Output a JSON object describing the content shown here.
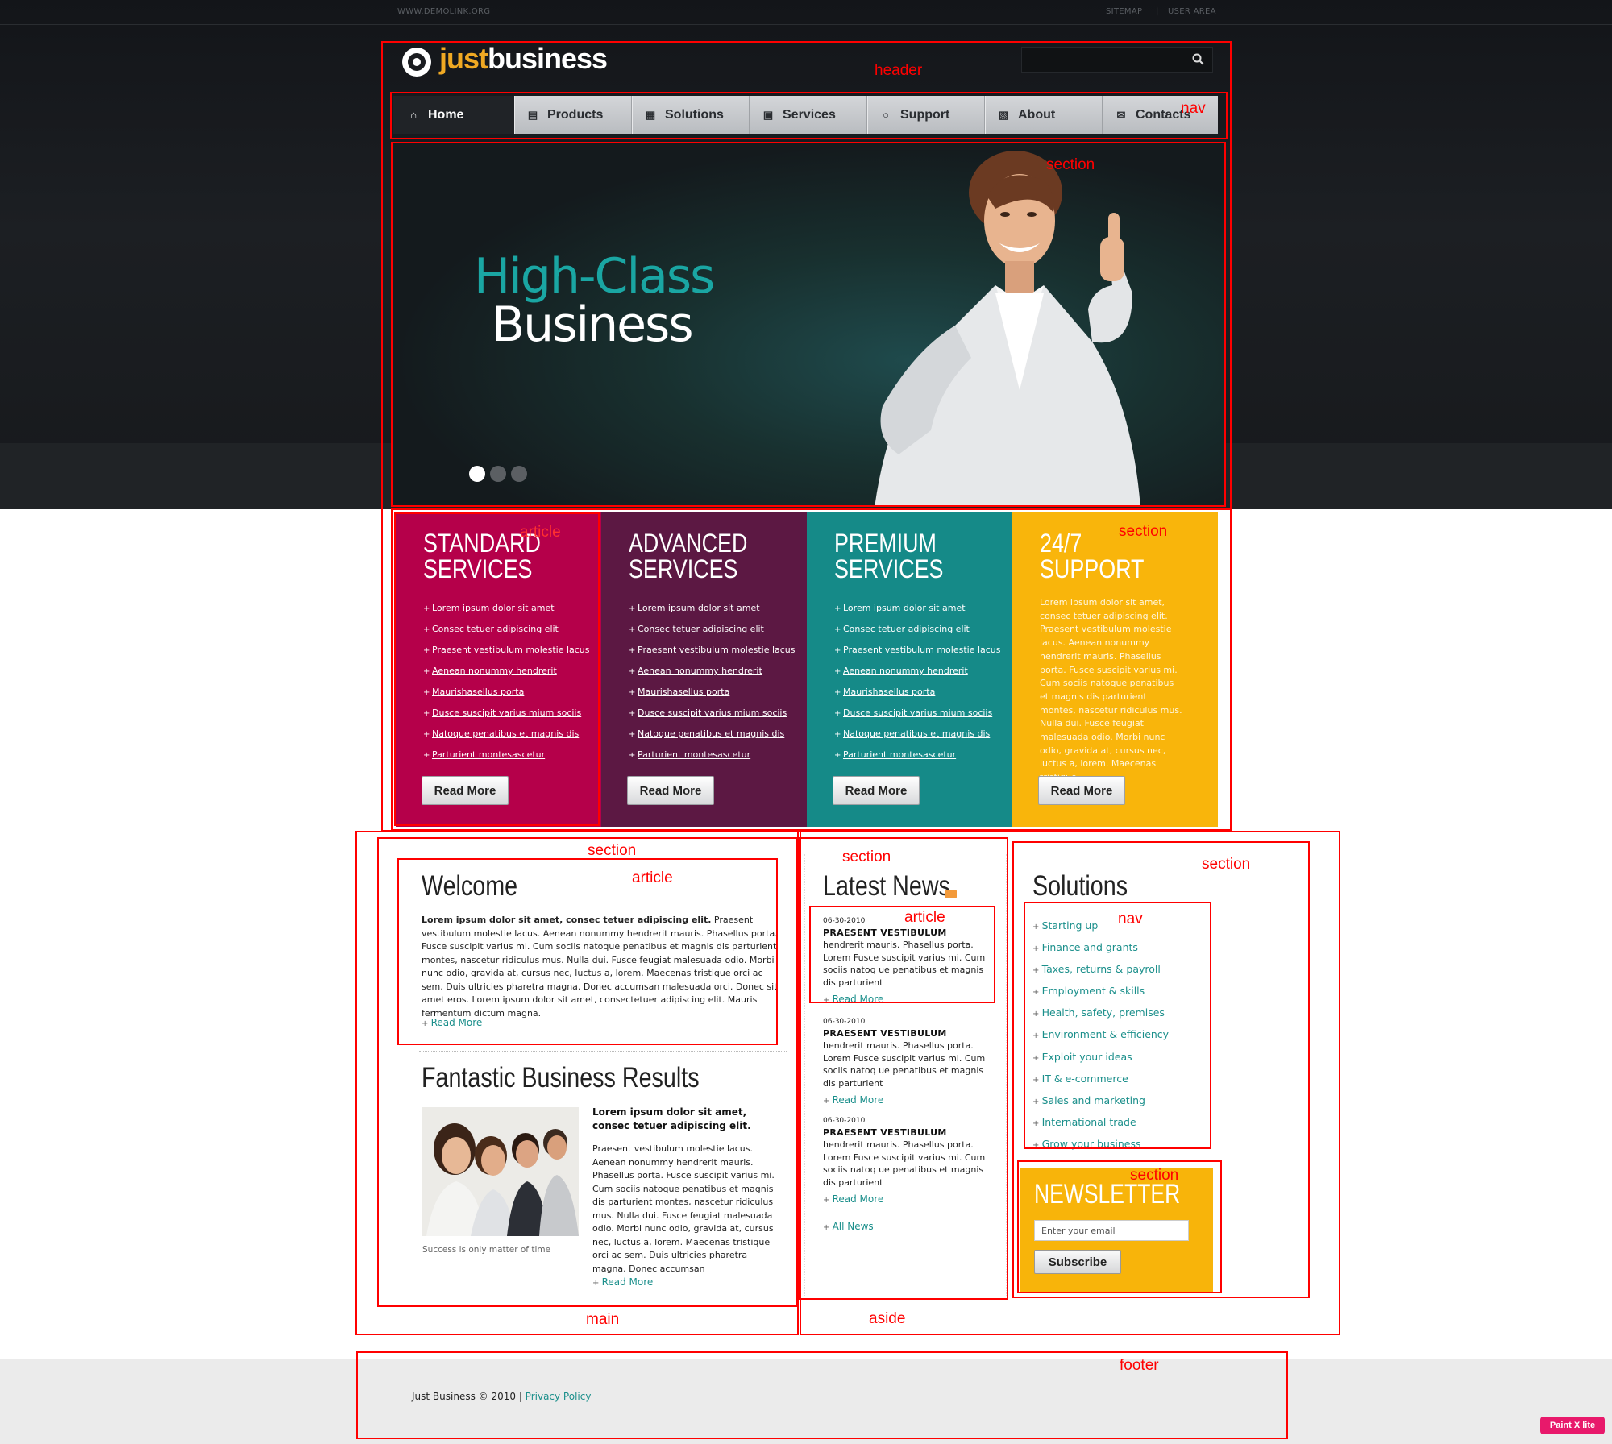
{
  "topbar": {
    "demolink": "WWW.DEMOLINK.ORG",
    "sitemap": "SITEMAP",
    "separator": "|",
    "userarea": "USER AREA"
  },
  "logo": {
    "just": "just",
    "business": "business"
  },
  "search": {
    "placeholder": ""
  },
  "nav": {
    "items": [
      {
        "label": "Home",
        "icon": "home-icon"
      },
      {
        "label": "Products",
        "icon": "products-icon"
      },
      {
        "label": "Solutions",
        "icon": "clipboard-icon"
      },
      {
        "label": "Services",
        "icon": "services-icon"
      },
      {
        "label": "Support",
        "icon": "support-icon"
      },
      {
        "label": "About",
        "icon": "about-icon"
      },
      {
        "label": "Contacts",
        "icon": "mail-icon"
      }
    ]
  },
  "slider": {
    "line1": "High-Class",
    "line2": "Business",
    "slide_count": 3,
    "active_slide": 1
  },
  "boxes": [
    {
      "title1": "STANDARD",
      "title2": "SERVICES",
      "color": "#b5004a"
    },
    {
      "title1": "ADVANCED",
      "title2": "SERVICES",
      "color": "#5c1843"
    },
    {
      "title1": "PREMIUM",
      "title2": "SERVICES",
      "color": "#158a88"
    },
    {
      "title1": "24/7",
      "title2": "SUPPORT",
      "color": "#f9b50b"
    }
  ],
  "box_links": [
    "Lorem ipsum dolor sit amet",
    "Consec tetuer adipiscing elit",
    "Praesent vestibulum molestie lacus",
    "Aenean nonummy hendrerit",
    "Maurishasellus porta",
    "Dusce suscipit varius mium sociis",
    "Natoque penatibus et magnis dis",
    "Parturient montesascetur"
  ],
  "support_text": "Lorem ipsum dolor sit amet, consec tetuer adipiscing elit. Praesent vestibulum molestie lacus. Aenean nonummy hendrerit mauris. Phasellus porta. Fusce suscipit varius mi. Cum sociis natoque penatibus et magnis dis parturient montes, nascetur ridiculus mus. Nulla dui. Fusce feugiat malesuada odio. Morbi nunc odio, gravida at, cursus nec, luctus a, lorem. Maecenas tristique",
  "read_more_button": "Read More",
  "welcome": {
    "title": "Welcome",
    "lead": "Lorem ipsum dolor sit amet, consec tetuer adipiscing elit.",
    "text": " Praesent vestibulum molestie lacus. Aenean nonummy hendrerit mauris. Phasellus porta. Fusce suscipit varius mi. Cum sociis natoque penatibus et magnis dis parturient montes, nascetur ridiculus mus. Nulla dui. Fusce feugiat malesuada odio. Morbi nunc odio, gravida at, cursus nec, luctus a, lorem. Maecenas tristique orci ac sem. Duis ultricies pharetra magna. Donec accumsan malesuada orci. Donec sit amet eros. Lorem ipsum dolor sit amet, consectetuer adipiscing elit. Mauris fermentum dictum magna.",
    "more": "Read More"
  },
  "results": {
    "title": "Fantastic Business Results",
    "caption": "Success is only matter of time",
    "lead": "Lorem ipsum dolor sit amet, consec tetuer adipiscing elit.",
    "text": "Praesent vestibulum molestie lacus. Aenean nonummy hendrerit mauris. Phasellus porta. Fusce suscipit varius mi. Cum sociis natoque penatibus et magnis dis parturient montes, nascetur ridiculus mus. Nulla dui. Fusce feugiat malesuada odio. Morbi nunc odio, gravida at, cursus nec, luctus a, lorem. Maecenas tristique orci ac sem. Duis ultricies pharetra magna. Donec accumsan",
    "more": "Read More"
  },
  "news": {
    "title": "Latest News",
    "items": [
      {
        "date": "06-30-2010",
        "title": "PRAESENT VESTIBULUM",
        "text": "hendrerit mauris. Phasellus porta. Lorem Fusce suscipit varius mi. Cum sociis natoq ue penatibus et magnis dis parturient",
        "more": "Read More"
      },
      {
        "date": "06-30-2010",
        "title": "PRAESENT VESTIBULUM",
        "text": "hendrerit mauris. Phasellus porta. Lorem Fusce suscipit varius mi. Cum sociis natoq ue penatibus et magnis dis parturient",
        "more": "Read More"
      },
      {
        "date": "06-30-2010",
        "title": "PRAESENT VESTIBULUM",
        "text": "hendrerit mauris. Phasellus porta. Lorem Fusce suscipit varius mi. Cum sociis natoq ue penatibus et magnis dis parturient",
        "more": "Read More"
      }
    ],
    "all": "All News"
  },
  "solutions": {
    "title": "Solutions",
    "items": [
      "Starting up",
      "Finance and grants",
      "Taxes, returns & payroll",
      "Employment & skills",
      "Health, safety, premises",
      "Environment & efficiency",
      "Exploit your ideas",
      "IT & e-commerce",
      "Sales and marketing",
      "International trade",
      "Grow your business"
    ]
  },
  "newsletter": {
    "title": "NEWSLETTER",
    "placeholder": "Enter your email",
    "button": "Subscribe"
  },
  "footer": {
    "copyright": "Just Business © 2010 | ",
    "privacy": "Privacy Policy"
  },
  "annotations": {
    "header": "header",
    "nav": "nav",
    "section": "section",
    "article": "article",
    "main": "main",
    "aside": "aside",
    "footer": "footer"
  },
  "watermark": "Paint X lite",
  "colors": {
    "accent_teal": "#1b8f8b",
    "logo_orange": "#f0a923",
    "annotation_red": "#ff0000"
  }
}
